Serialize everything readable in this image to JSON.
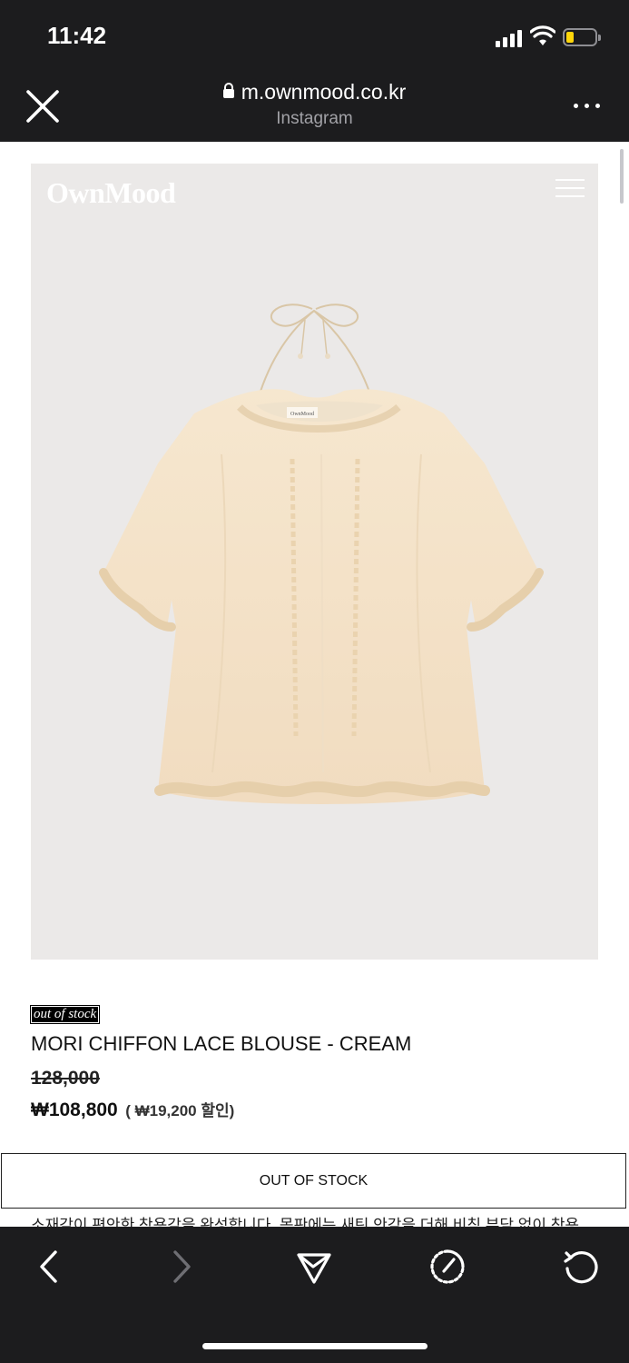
{
  "status_bar": {
    "time": "11:42",
    "signal_icon": "cellular-signal-icon",
    "wifi_icon": "wifi-icon",
    "battery_icon": "battery-low-icon",
    "battery_level": 0.2,
    "battery_color": "#ffd60a"
  },
  "browser": {
    "url": "m.ownmood.co.kr",
    "source": "Instagram",
    "close_icon": "close-icon",
    "lock_icon": "lock-icon",
    "more_icon": "more-dots-icon"
  },
  "site": {
    "logo": "OwnMood",
    "menu_icon": "hamburger-menu-icon",
    "image_bg": "#ebe9e8",
    "garment_label": "OwnMood"
  },
  "product": {
    "stock_tag": "out of stock",
    "name": "MORI CHIFFON LACE BLOUSE - CREAM",
    "original_price": "128,000",
    "sale_price": "₩108,800",
    "discount": "( ₩19,200 할인)",
    "button_label": "OUT OF STOCK",
    "description": "소재감이 편안한 착용감을 완성합니다. 몸판에는 새틴 안감을 더해 비침 부담 없이 착용"
  },
  "toolbar": {
    "back_icon": "back-arrow-icon",
    "forward_icon": "forward-arrow-icon",
    "share_icon": "send-icon",
    "speed_icon": "speedometer-icon",
    "reload_icon": "reload-icon"
  }
}
